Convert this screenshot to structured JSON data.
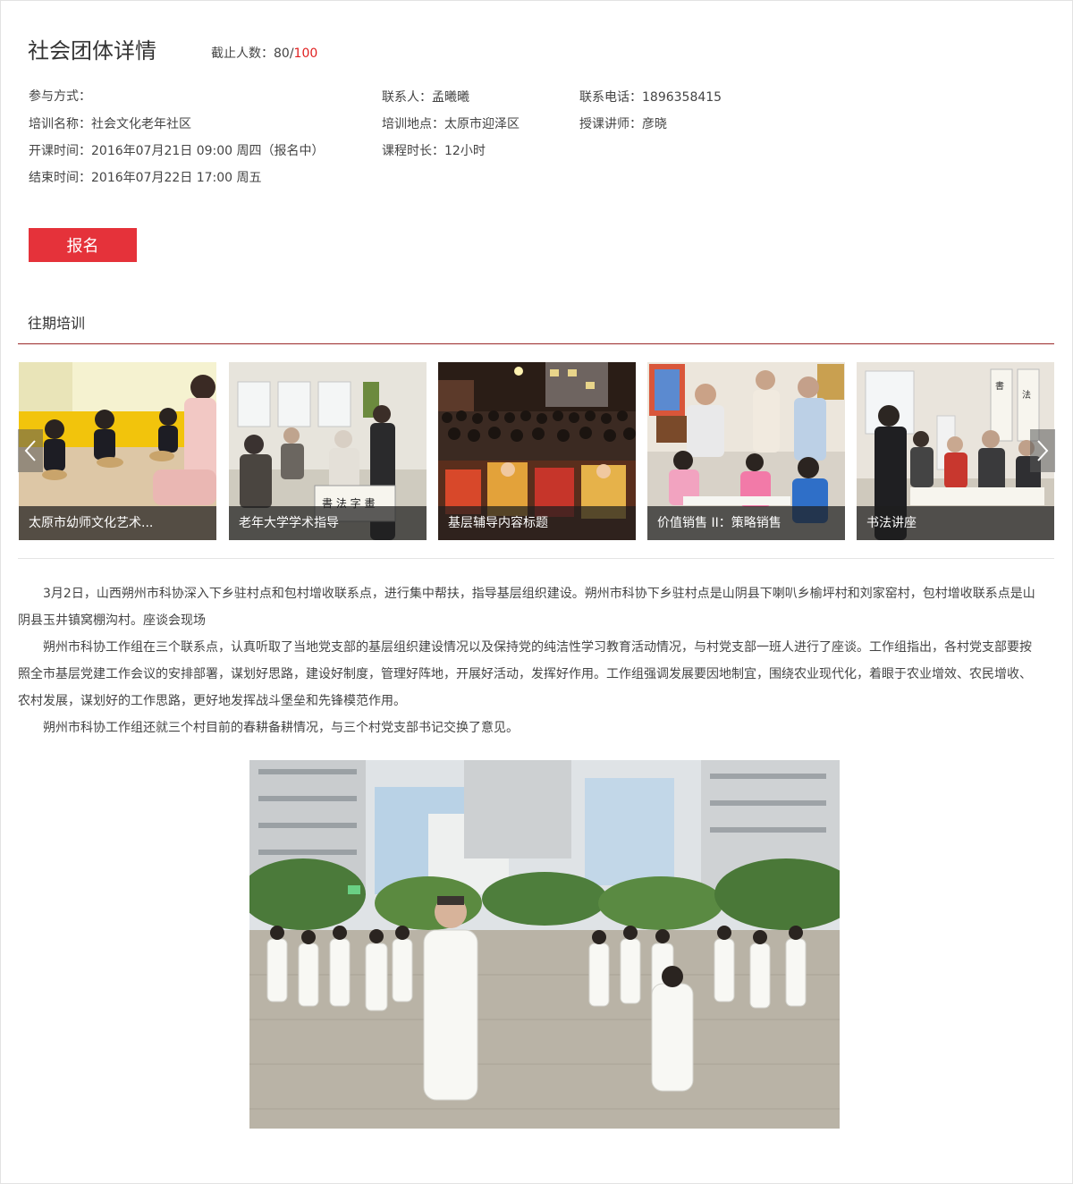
{
  "header": {
    "title": "社会团体详情",
    "cutoff_label": "截止人数：80/",
    "cutoff_max": "100"
  },
  "info": {
    "participation": "参与方式：",
    "training_name": "培训名称：社会文化老年社区",
    "start_time": "开课时间：2016年07月21日 09:00 周四（报名中）",
    "end_time": "结束时间：2016年07月22日 17:00 周五",
    "contact": "联系人：孟曦曦",
    "location": "培训地点：太原市迎泽区",
    "duration": "课程时长：12小时",
    "phone": "联系电话：1896358415",
    "instructor": "授课讲师：彦晓"
  },
  "signup_label": "报名",
  "past_section": {
    "title": "往期培训",
    "items": [
      {
        "caption": "太原市幼师文化艺术..."
      },
      {
        "caption": "老年大学学术指导"
      },
      {
        "caption": "基层辅导内容标题"
      },
      {
        "caption": "价值销售 II：策略销售"
      },
      {
        "caption": "书法讲座"
      }
    ],
    "prev_icon": "chevron-left-icon",
    "next_icon": "chevron-right-icon"
  },
  "article": {
    "paragraphs": [
      "3月2日，山西朔州市科协深入下乡驻村点和包村增收联系点，进行集中帮扶，指导基层组织建设。朔州市科协下乡驻村点是山阴县下喇叭乡榆坪村和刘家窑村，包村增收联系点是山阴县玉井镇窝棚沟村。座谈会现场",
      "朔州市科协工作组在三个联系点，认真听取了当地党支部的基层组织建设情况以及保持党的纯洁性学习教育活动情况，与村党支部一班人进行了座谈。工作组指出，各村党支部要按照全市基层党建工作会议的安排部署，谋划好思路，建设好制度，管理好阵地，开展好活动，发挥好作用。工作组强调发展要因地制宜，围绕农业现代化，着眼于农业增效、农民增收、农村发展，谋划好的工作思路，更好地发挥战斗堡垒和先锋模范作用。",
      "朔州市科协工作组还就三个村目前的春耕备耕情况，与三个村党支部书记交换了意见。"
    ]
  },
  "colors": {
    "accent": "#e5323a",
    "count_max": "#e02020",
    "section_rule": "#9b2a2a"
  }
}
